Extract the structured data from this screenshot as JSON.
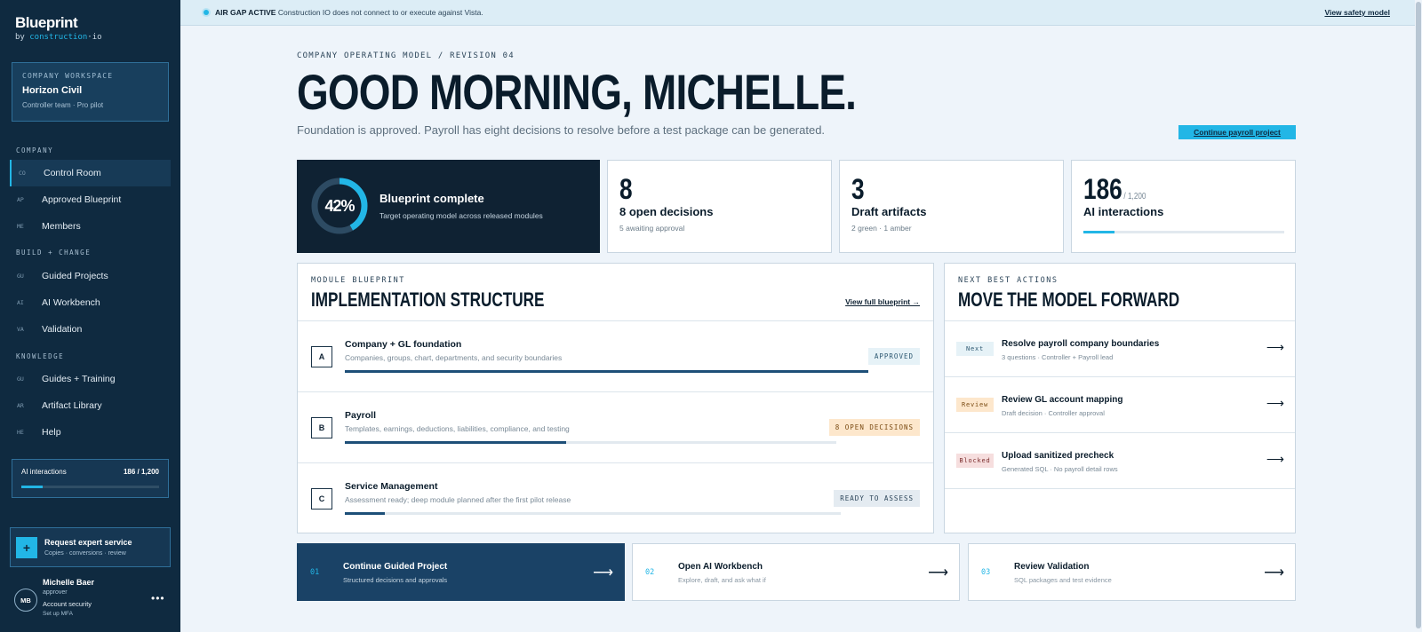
{
  "brand": {
    "name": "Blueprint",
    "by_prefix": "by ",
    "by_accent": "construction",
    "by_suffix": "·io"
  },
  "workspace": {
    "label": "COMPANY WORKSPACE",
    "name": "Horizon Civil",
    "sub": "Controller team · Pro pilot"
  },
  "nav": {
    "company_label": "COMPANY",
    "build_label": "BUILD + CHANGE",
    "knowledge_label": "KNOWLEDGE",
    "items": [
      {
        "abbr": "CO",
        "label": "Control Room"
      },
      {
        "abbr": "AP",
        "label": "Approved Blueprint"
      },
      {
        "abbr": "ME",
        "label": "Members"
      },
      {
        "abbr": "GU",
        "label": "Guided Projects"
      },
      {
        "abbr": "AI",
        "label": "AI Workbench"
      },
      {
        "abbr": "VA",
        "label": "Validation"
      },
      {
        "abbr": "GU",
        "label": "Guides + Training"
      },
      {
        "abbr": "AR",
        "label": "Artifact Library"
      },
      {
        "abbr": "HE",
        "label": "Help"
      }
    ]
  },
  "sidebar_ai": {
    "label": "AI interactions",
    "value": "186 / 1,200",
    "progress": 0.155
  },
  "expert": {
    "icon": "plus-icon",
    "title": "Request expert service",
    "sub": "Copies · conversions · review"
  },
  "user": {
    "initials": "MB",
    "name": "Michelle Baer",
    "role": "approver",
    "security": "Account security",
    "mfa": "Set up MFA"
  },
  "banner": {
    "status": "AIR GAP ACTIVE",
    "text": " Construction IO does not connect to or execute against Vista.",
    "link": "View safety model"
  },
  "hero": {
    "eyebrow": "COMPANY OPERATING MODEL / REVISION 04",
    "title": "GOOD MORNING, MICHELLE.",
    "subtitle": "Foundation is approved. Payroll has eight decisions to resolve before a test package can be generated.",
    "cta": "Continue payroll project"
  },
  "stats": {
    "blueprint": {
      "percent": "42%",
      "value": 0.42,
      "title": "Blueprint complete",
      "sub": "Target operating model across released modules"
    },
    "decisions": {
      "num": "8",
      "title": "8 open decisions",
      "sub": "5 awaiting approval"
    },
    "artifacts": {
      "num": "3",
      "title": "Draft artifacts",
      "sub": "2 green · 1 amber"
    },
    "ai": {
      "num": "186",
      "of": "/ 1,200",
      "title": "AI interactions",
      "progress": 0.155
    }
  },
  "structure": {
    "eyebrow": "MODULE BLUEPRINT",
    "title": "IMPLEMENTATION STRUCTURE",
    "link": "View full blueprint →",
    "modules": [
      {
        "letter": "A",
        "name": "Company + GL foundation",
        "desc": "Companies, groups, chart, departments, and security boundaries",
        "tag": "APPROVED",
        "progress": 1.0
      },
      {
        "letter": "B",
        "name": "Payroll",
        "desc": "Templates, earnings, deductions, liabilities, compliance, and testing",
        "tag": "8 OPEN DECISIONS",
        "progress": 0.45
      },
      {
        "letter": "C",
        "name": "Service Management",
        "desc": "Assessment ready; deep module planned after the first pilot release",
        "tag": "READY TO ASSESS",
        "progress": 0.08
      }
    ]
  },
  "actions": {
    "eyebrow": "NEXT BEST ACTIONS",
    "title": "MOVE THE MODEL FORWARD",
    "items": [
      {
        "tag": "Next",
        "title": "Resolve payroll company boundaries",
        "sub": "3 questions · Controller + Payroll lead",
        "arrow": "⟶"
      },
      {
        "tag": "Review",
        "title": "Review GL account mapping",
        "sub": "Draft decision · Controller approval",
        "arrow": "⟶"
      },
      {
        "tag": "Blocked",
        "title": "Upload sanitized precheck",
        "sub": "Generated SQL · No payroll detail rows",
        "arrow": "⟶"
      }
    ]
  },
  "cards": [
    {
      "num": "01",
      "title": "Continue Guided Project",
      "sub": "Structured decisions and approvals",
      "arrow": "⟶"
    },
    {
      "num": "02",
      "title": "Open AI Workbench",
      "sub": "Explore, draft, and ask what if",
      "arrow": "⟶"
    },
    {
      "num": "03",
      "title": "Review Validation",
      "sub": "SQL packages and test evidence",
      "arrow": "⟶"
    }
  ],
  "colors": {
    "accent": "#22b6e6",
    "navy": "#0f2a40",
    "approved": "#1d4f78",
    "amber": "#fde7cc"
  }
}
